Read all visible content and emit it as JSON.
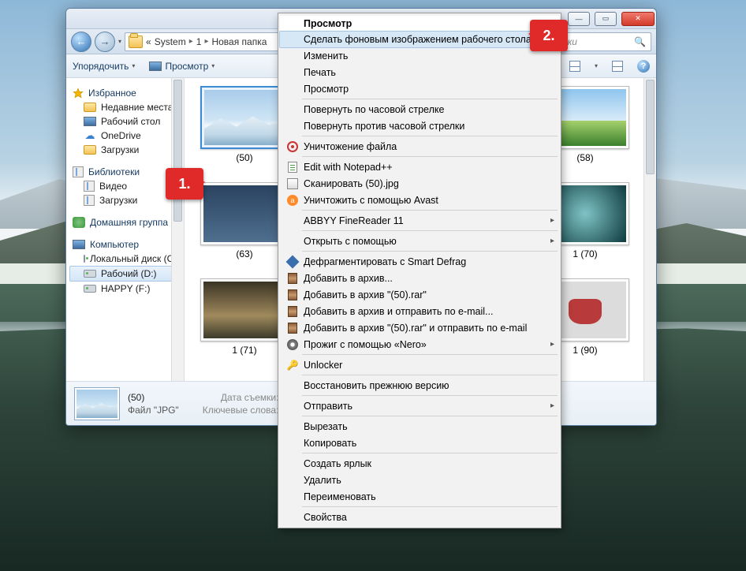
{
  "path": {
    "prefix": "«",
    "seg1": "System",
    "seg2": "1",
    "seg3": "Новая папка"
  },
  "search_placeholder": "нки",
  "toolbar": {
    "organize": "Упорядочить",
    "preview": "Просмотр"
  },
  "winctrl": {
    "min": "—",
    "max": "▭",
    "close": "✕"
  },
  "sidebar": {
    "favorites": "Избранное",
    "fav_items": [
      "Недавние места",
      "Рабочий стол",
      "OneDrive",
      "Загрузки"
    ],
    "libraries": "Библиотеки",
    "lib_items": [
      "Видео",
      "Загрузки"
    ],
    "homegroup": "Домашняя группа",
    "computer": "Компьютер",
    "drives": [
      "Локальный диск (C:)",
      "Рабочий (D:)",
      "HAPPY (F:)"
    ]
  },
  "thumbs": [
    {
      "cap": "(50)",
      "sel": true,
      "cls": "p-mtn"
    },
    {
      "cap": "(58)",
      "cls": "p-green"
    },
    {
      "cap": "(63)",
      "cls": "p-city"
    },
    {
      "cap": "1 (70)",
      "cls": "p-abstr"
    },
    {
      "cap": "1 (71)",
      "cls": "p-sunset"
    },
    {
      "cap": "1 (90)",
      "cls": "p-moto"
    }
  ],
  "road_cap": "",
  "details": {
    "name": "(50)",
    "type": "Файл \"JPG\"",
    "datelab": "Дата съемки:",
    "keylab": "Ключевые слова:"
  },
  "callouts": {
    "c1": "1.",
    "c2": "2."
  },
  "ctx": {
    "head": "Просмотр",
    "g1": [
      "Сделать фоновым изображением рабочего стола",
      "Изменить",
      "Печать",
      "Просмотр"
    ],
    "g2": [
      "Повернуть по часовой стрелке",
      "Повернуть против часовой стрелки"
    ],
    "destroy": "Уничтожение файла",
    "npp": "Edit with Notepad++",
    "scan": "Сканировать (50).jpg",
    "avast": "Уничтожить с помощью Avast",
    "abbyy": "ABBYY FineReader 11",
    "openwith": "Открыть с помощью",
    "defrag": "Дефрагментировать с Smart Defrag",
    "rar": [
      "Добавить в архив...",
      "Добавить в архив \"(50).rar\"",
      "Добавить в архив и отправить по e-mail...",
      "Добавить в архив \"(50).rar\" и отправить по e-mail"
    ],
    "nero": "Прожиг с помощью «Nero»",
    "unlocker": "Unlocker",
    "restore": "Восстановить прежнюю версию",
    "send": "Отправить",
    "cut": "Вырезать",
    "copy": "Копировать",
    "shortcut": "Создать ярлык",
    "delete": "Удалить",
    "rename": "Переименовать",
    "props": "Свойства"
  }
}
